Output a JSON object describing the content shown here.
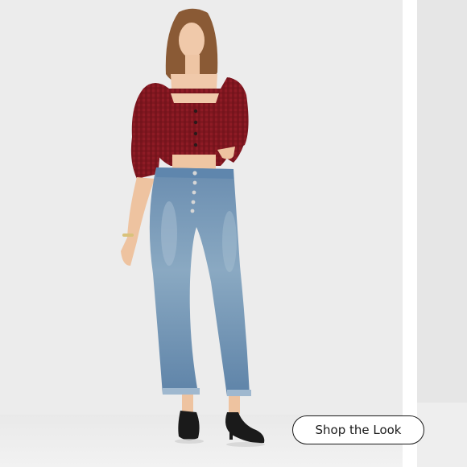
{
  "image": {
    "subject": "model-in-red-gingham-crop-top-and-cropped-jeans",
    "colors": {
      "background": "#ececec",
      "panel": "#e6e6e6",
      "top": "#8e1b25",
      "jeans": "#6f93b3",
      "shoes": "#1a1a1a"
    }
  },
  "cta": {
    "label": "Shop the Look"
  }
}
